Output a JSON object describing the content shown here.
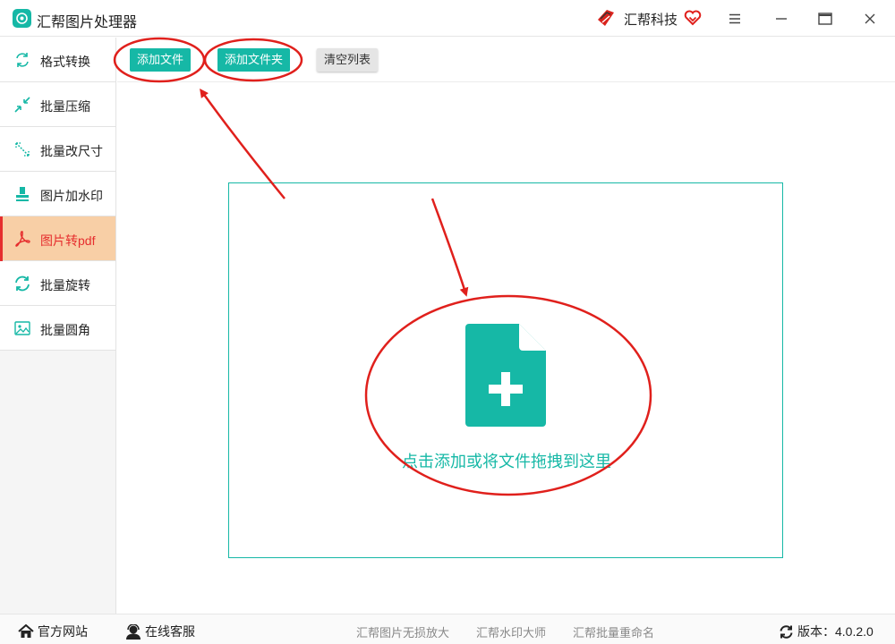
{
  "app": {
    "title": "汇帮图片处理器",
    "brand": "汇帮科技"
  },
  "window_controls": [
    "menu-icon",
    "minimize-icon",
    "maximize-icon",
    "close-icon"
  ],
  "sidebar": {
    "items": [
      {
        "label": "格式转换",
        "icon": "format-convert-icon",
        "active": false
      },
      {
        "label": "批量压缩",
        "icon": "compress-icon",
        "active": false
      },
      {
        "label": "批量改尺寸",
        "icon": "resize-icon",
        "active": false
      },
      {
        "label": "图片加水印",
        "icon": "watermark-icon",
        "active": false
      },
      {
        "label": "图片转pdf",
        "icon": "pdf-icon",
        "active": true
      },
      {
        "label": "批量旋转",
        "icon": "rotate-icon",
        "active": false
      },
      {
        "label": "批量圆角",
        "icon": "rounded-corner-icon",
        "active": false
      }
    ]
  },
  "toolbar": {
    "add_file": "添加文件",
    "add_folder": "添加文件夹",
    "clear_list": "清空列表"
  },
  "dropzone": {
    "text": "点击添加或将文件拖拽到这里",
    "icon": "add-document-icon"
  },
  "footer": {
    "website": "官方网站",
    "support": "在线客服",
    "links": [
      "汇帮图片无损放大",
      "汇帮水印大师",
      "汇帮批量重命名"
    ],
    "version": "版本：4.0.2.0"
  },
  "colors": {
    "accent": "#16b8a6",
    "active_bg": "#f8cfa6",
    "active_text": "#e62e2e",
    "annotation": "#e0201c"
  }
}
